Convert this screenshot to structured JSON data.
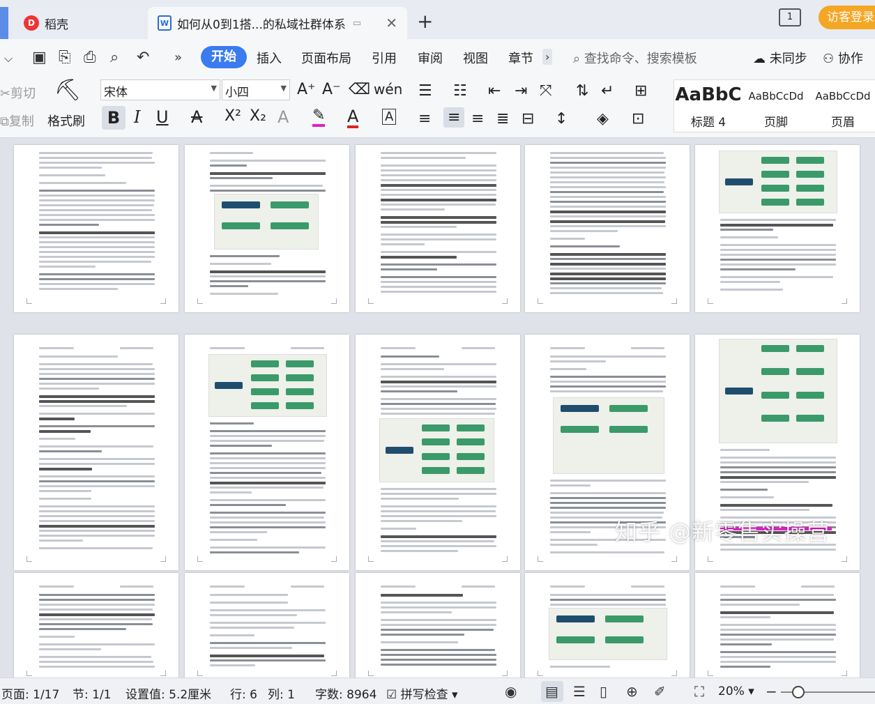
{
  "titlebar": {
    "app_tab": "稻壳",
    "doc_tab": "如何从0到1搭...的私域社群体系",
    "close_glyph": "✕",
    "new_tab": "+",
    "window_count": "1",
    "guest_login": "访客登录"
  },
  "menubar": {
    "items": [
      "开始",
      "插入",
      "页面布局",
      "引用",
      "审阅",
      "视图",
      "章节"
    ],
    "search_placeholder": "查找命令、搜索模板",
    "sync_status": "未同步",
    "collaborate": "协作"
  },
  "ribbon": {
    "cut": "剪切",
    "copy": "复制",
    "format_painter": "格式刷",
    "font_name": "宋体",
    "font_size": "小四",
    "styles": [
      {
        "sample": "AaBbC",
        "name": "标题 4"
      },
      {
        "sample": "AaBbCcDd",
        "name": "页脚"
      },
      {
        "sample": "AaBbCcDd",
        "name": "页眉"
      }
    ]
  },
  "watermark": "知乎 @新零售实操营",
  "statusbar": {
    "page": "页面: 1/17",
    "section": "节: 1/1",
    "setting": "设置值: 5.2厘米",
    "row": "行: 6",
    "col": "列: 1",
    "word_count": "字数: 8964",
    "spell_check": "拼写检查",
    "zoom": "20%"
  },
  "colors": {
    "accent": "#3a7bf0",
    "guest_button": "#f5a623",
    "highlight": "#e020c8",
    "figure_green": "#3a9a6a"
  }
}
